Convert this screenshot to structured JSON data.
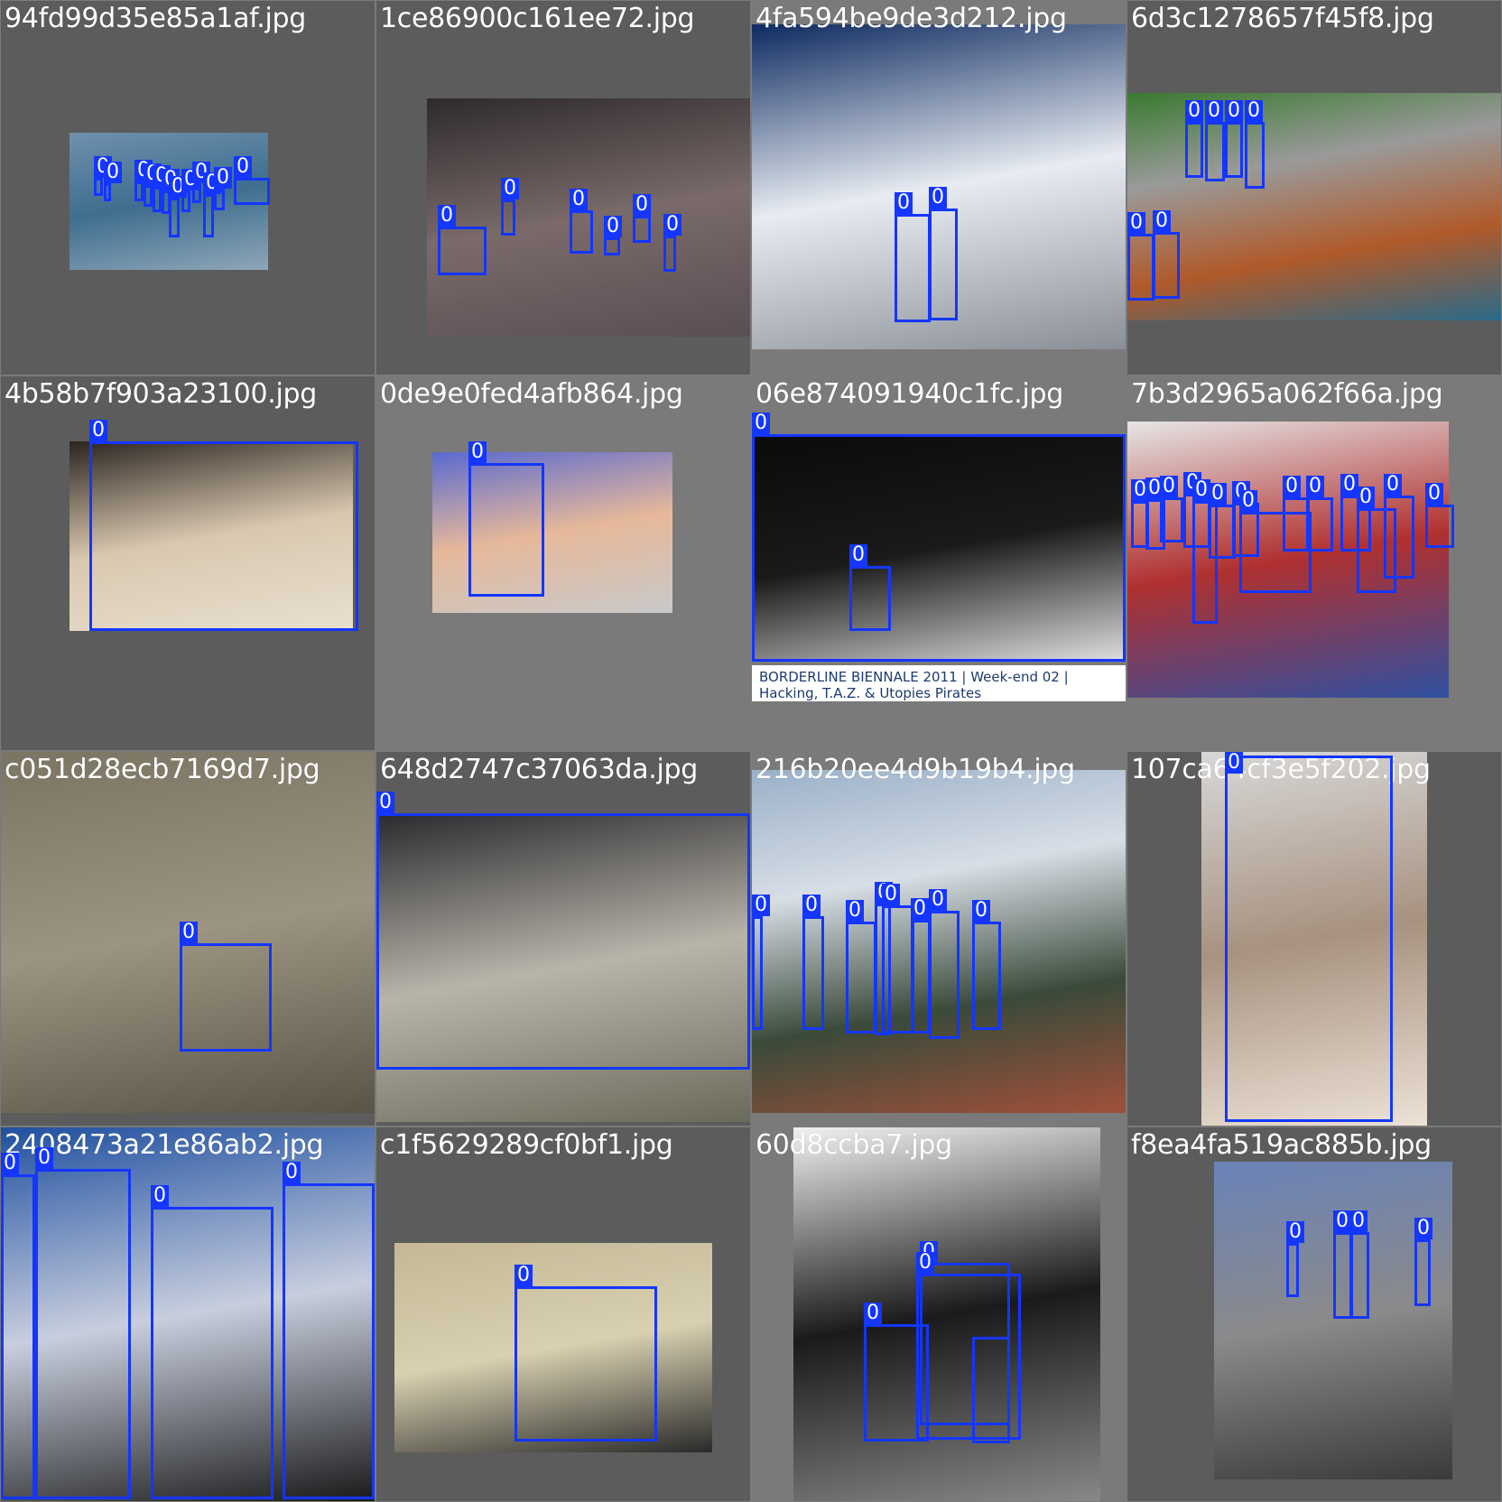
{
  "tiles": [
    {
      "filename": "94fd99d35e85a1af.jpg",
      "bg": "#5c5c5c",
      "photo_colors": [
        "#6f90ad",
        "#3f6e8f",
        "#8ea6b8"
      ],
      "labels": [
        "0",
        "0",
        "0",
        "0",
        "0",
        "0",
        "0",
        "0",
        "0",
        "0",
        "0",
        "0"
      ]
    },
    {
      "filename": "1ce86900c161ee72.jpg",
      "bg": "#5c5c5c",
      "photo_colors": [
        "#2e2a2c",
        "#7a6a6a",
        "#5a4e52"
      ],
      "labels": [
        "0",
        "0",
        "0",
        "0",
        "0",
        "0"
      ]
    },
    {
      "filename": "4fa594be9de3d212.jpg",
      "bg": "#7a7a7a",
      "photo_colors": [
        "#0e2a60",
        "#e8ecf2",
        "#8a8e96"
      ],
      "labels": [
        "0",
        "0"
      ]
    },
    {
      "filename": "6d3c1278657f45f8.jpg",
      "bg": "#5c5c5c",
      "photo_colors": [
        "#3a7a30",
        "#9a9a9a",
        "#b05a2a",
        "#2a6a8a"
      ],
      "labels": [
        "0",
        "0",
        "0",
        "0",
        "0",
        "0"
      ]
    },
    {
      "filename": "4b58b7f903a23100.jpg",
      "bg": "#5c5c5c",
      "photo_colors": [
        "#2a2420",
        "#d9c8b0",
        "#e8e0d0"
      ],
      "labels": [
        "0"
      ]
    },
    {
      "filename": "0de9e0fed4afb864.jpg",
      "bg": "#7a7a7a",
      "photo_colors": [
        "#5a6ad0",
        "#e6b89a",
        "#c9c9c9"
      ],
      "labels": [
        "0"
      ]
    },
    {
      "filename": "06e874091940c1fc.jpg",
      "bg": "#7a7a7a",
      "photo_colors": [
        "#0a0a0a",
        "#1a1a1a",
        "#e0e0e0"
      ],
      "labels": [
        "0",
        "0"
      ],
      "caption_line1": "BORDERLINE BIENNALE 2011 | Week-end 02 |",
      "caption_line2": "Hacking, T.A.Z. & Utopies Pirates"
    },
    {
      "filename": "7b3d2965a062f66a.jpg",
      "bg": "#7a7a7a",
      "photo_colors": [
        "#e6e6e6",
        "#b03030",
        "#3050a0"
      ],
      "labels": [
        "0",
        "0",
        "0",
        "0",
        "0",
        "0",
        "0",
        "0",
        "0",
        "0",
        "0",
        "0",
        "0",
        "0"
      ]
    },
    {
      "filename": "c051d28ecb7169d7.jpg",
      "bg": "#5c5c5c",
      "photo_colors": [
        "#7a7462",
        "#9c9482",
        "#5a5446"
      ],
      "labels": [
        "0"
      ]
    },
    {
      "filename": "648d2747c37063da.jpg",
      "bg": "#5c5c5c",
      "photo_colors": [
        "#2a2a2e",
        "#b8b4aa",
        "#6a6a5a"
      ],
      "labels": [
        "0"
      ]
    },
    {
      "filename": "216b20ee4d9b19b4.jpg",
      "bg": "#7a7a7a",
      "photo_colors": [
        "#9ab0c8",
        "#d8dee6",
        "#3a4a3a",
        "#a0503a"
      ],
      "labels": [
        "0",
        "0",
        "0",
        "0",
        "0",
        "0",
        "0",
        "0"
      ]
    },
    {
      "filename": "107ca64cf3e5f202.jpg",
      "bg": "#5c5c5c",
      "photo_colors": [
        "#d8d8d8",
        "#a89280",
        "#ece2d6"
      ],
      "labels": [
        "0"
      ]
    },
    {
      "filename": "2408473a21e86ab2.jpg",
      "bg": "#5c5c5c",
      "photo_colors": [
        "#2050a0",
        "#c8cede",
        "#1a1a1a"
      ],
      "labels": [
        "0",
        "0",
        "0",
        "0"
      ]
    },
    {
      "filename": "c1f5629289cf0bf1.jpg",
      "bg": "#5c5c5c",
      "photo_colors": [
        "#c4b896",
        "#d8d0b0",
        "#2a2a2a"
      ],
      "labels": [
        "0"
      ]
    },
    {
      "filename": "60d8ccba7.jpg",
      "bg": "#7a7a7a",
      "photo_colors": [
        "#f2f2f2",
        "#1a1a1a",
        "#888888"
      ],
      "labels": [
        "0",
        "0",
        "0"
      ]
    },
    {
      "filename": "f8ea4fa519ac885b.jpg",
      "bg": "#5c5c5c",
      "photo_colors": [
        "#6a82b8",
        "#8a8a8a",
        "#3a3a3a"
      ],
      "labels": [
        "0",
        "0",
        "0",
        "0"
      ]
    }
  ],
  "colors": {
    "box": "#1436ff",
    "label_text": "#ffffff",
    "filename_text": "#ffffff"
  }
}
